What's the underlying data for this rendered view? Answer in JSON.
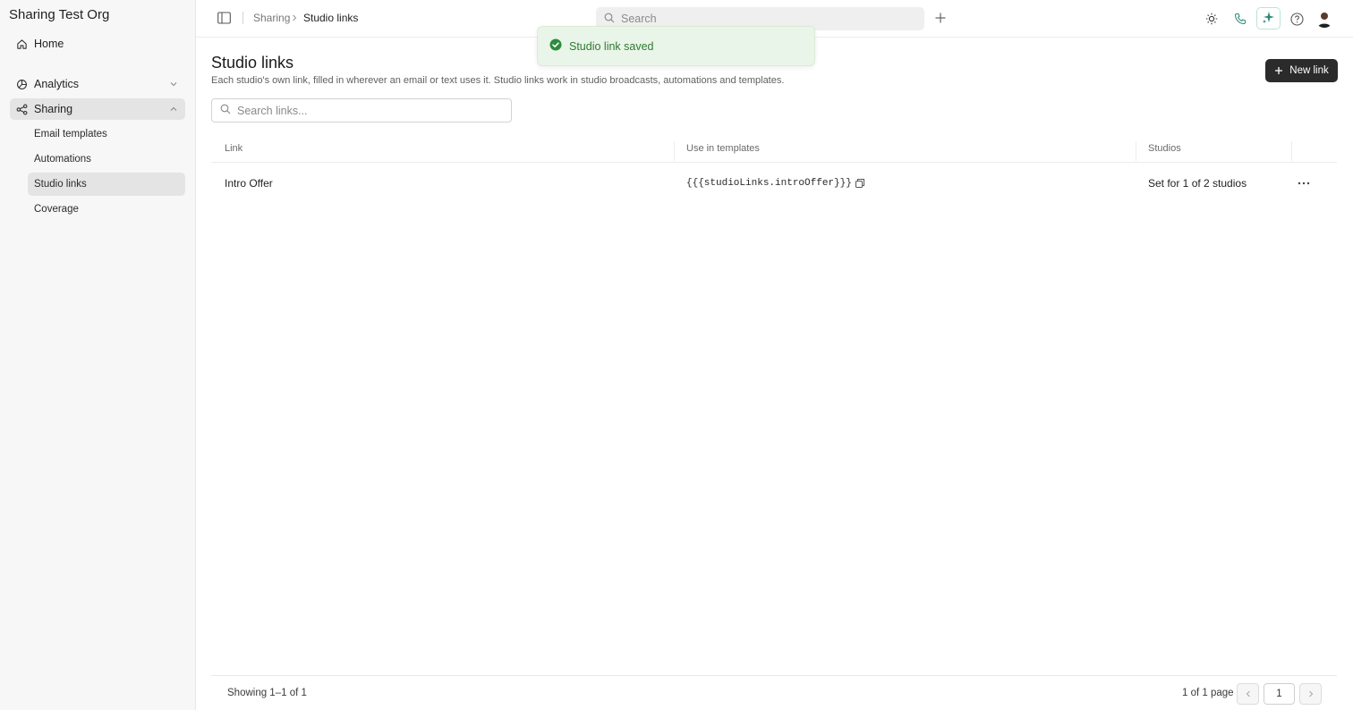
{
  "sidebar": {
    "org_name": "Sharing Test Org",
    "home_label": "Home",
    "analytics_label": "Analytics",
    "sharing_label": "Sharing",
    "sub_items": [
      "Email templates",
      "Automations",
      "Studio links",
      "Coverage"
    ]
  },
  "topbar": {
    "breadcrumb_parent": "Sharing",
    "breadcrumb_current": "Studio links",
    "search_placeholder": "Search",
    "icons": [
      "sidebar-toggle-icon",
      "plus-icon",
      "sun-icon",
      "phone-icon",
      "sparkle-icon",
      "help-icon",
      "avatar"
    ],
    "accent_color": "#2e8b7a"
  },
  "toast": {
    "message": "Studio link saved",
    "color": "#2f7a32",
    "background": "#eaf5e9"
  },
  "page": {
    "title": "Studio links",
    "description": "Each studio's own link, filled in wherever an email or text uses it. Studio links work in studio broadcasts, automations and templates.",
    "new_button_label": "New link",
    "search_placeholder": "Search links..."
  },
  "table": {
    "columns": [
      "Link",
      "Use in templates",
      "Studios"
    ],
    "rows": [
      {
        "link": "Intro Offer",
        "template_var": "{{{studioLinks.introOffer}}}",
        "studios": "Set for 1 of 2 studios"
      }
    ]
  },
  "footer": {
    "showing": "Showing 1–1 of 1",
    "page_info": "1 of 1 page",
    "current_page": "1"
  }
}
